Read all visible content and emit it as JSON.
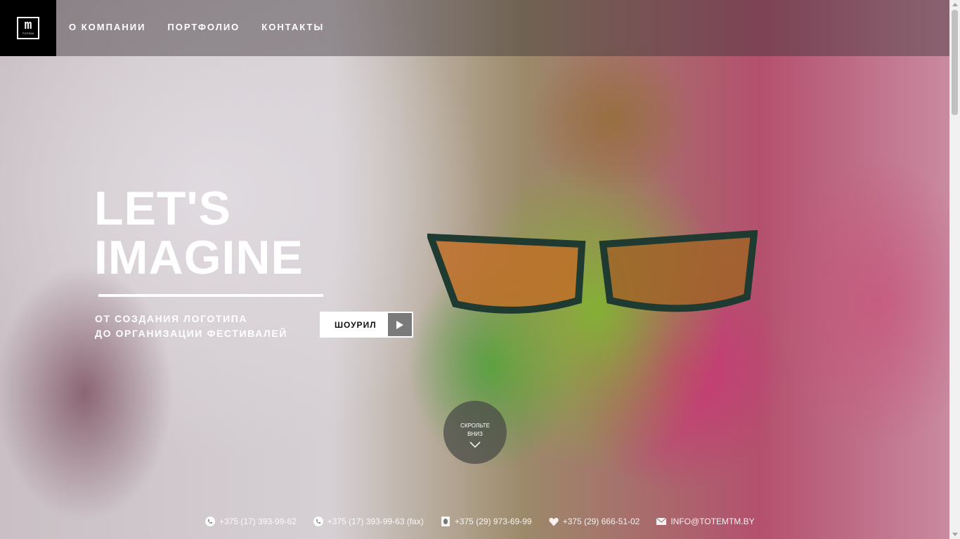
{
  "logo": {
    "mark": "m",
    "text": "TOTEM"
  },
  "nav": {
    "items": [
      {
        "label": "О КОМПАНИИ"
      },
      {
        "label": "ПОРТФОЛИО"
      },
      {
        "label": "КОНТАКТЫ"
      }
    ]
  },
  "hero": {
    "headline_line1": "LET'S",
    "headline_line2": "IMAGINE",
    "subline_line1": "ОТ СОЗДАНИЯ ЛОГОТИПА",
    "subline_line2": "ДО ОРГАНИЗАЦИИ ФЕСТИВАЛЕЙ",
    "showreel_label": "ШОУРИЛ",
    "scroll_line1": "СКРОЛЬТЕ",
    "scroll_line2": "ВНИЗ"
  },
  "contacts": [
    {
      "icon": "phone-icon",
      "text": "+375 (17) 393-99-62"
    },
    {
      "icon": "phone-icon",
      "text": "+375 (17) 393-99-63 (fax)"
    },
    {
      "icon": "mobile-icon",
      "text": "+375 (29) 973-69-99"
    },
    {
      "icon": "heart-icon",
      "text": "+375 (29) 666-51-02"
    },
    {
      "icon": "mail-icon",
      "text": "INFO@TOTEMTM.BY"
    }
  ],
  "colors": {
    "logo_bg": "#000000",
    "nav_text": "#ffffff",
    "button_bg": "#ffffff",
    "button_play_bg": "#7a7a7a"
  }
}
